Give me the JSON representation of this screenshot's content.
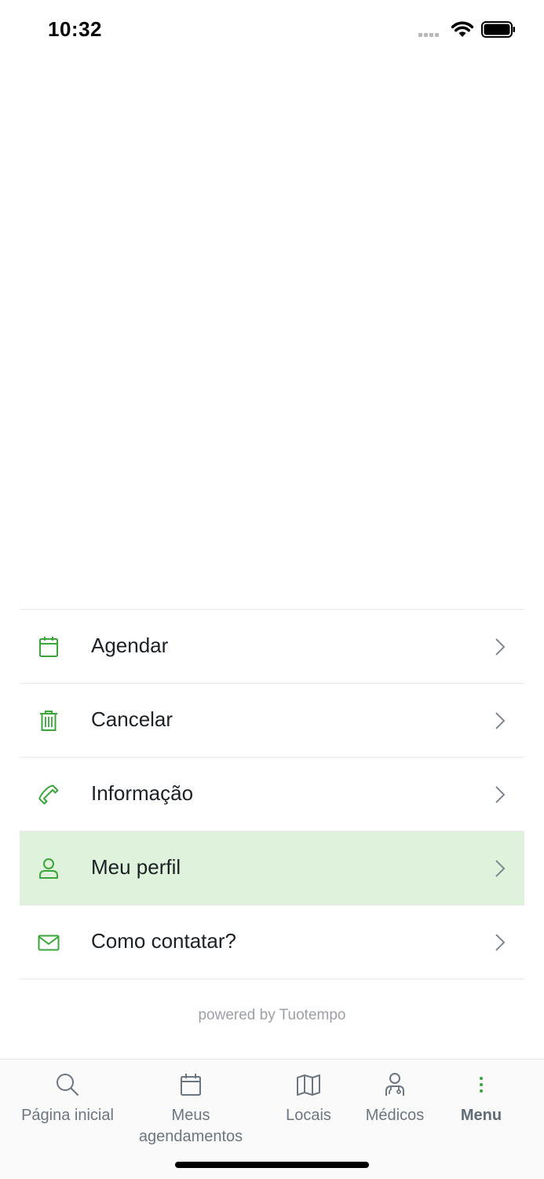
{
  "status_bar": {
    "time": "10:32"
  },
  "menu": {
    "items": [
      {
        "label": "Agendar",
        "icon": "calendar-icon",
        "active": false
      },
      {
        "label": "Cancelar",
        "icon": "trash-icon",
        "active": false
      },
      {
        "label": "Informação",
        "icon": "phone-icon",
        "active": false
      },
      {
        "label": "Meu perfil",
        "icon": "user-icon",
        "active": true
      },
      {
        "label": "Como contatar?",
        "icon": "mail-icon",
        "active": false
      }
    ]
  },
  "footer": {
    "powered_by": "powered by Tuotempo"
  },
  "tab_bar": {
    "tabs": [
      {
        "label": "Página inicial",
        "icon": "search-icon",
        "selected": false
      },
      {
        "label": "Meus agendamentos",
        "icon": "calendar-icon",
        "selected": false
      },
      {
        "label": "Locais",
        "icon": "map-icon",
        "selected": false
      },
      {
        "label": "Médicos",
        "icon": "doctor-icon",
        "selected": false
      },
      {
        "label": "Menu",
        "icon": "more-vertical-icon",
        "selected": true
      }
    ]
  },
  "colors": {
    "accent_green": "#3aa63a",
    "active_row": "#dff2dc",
    "divider": "#e8e8e8",
    "tab_text": "#6c7680"
  }
}
